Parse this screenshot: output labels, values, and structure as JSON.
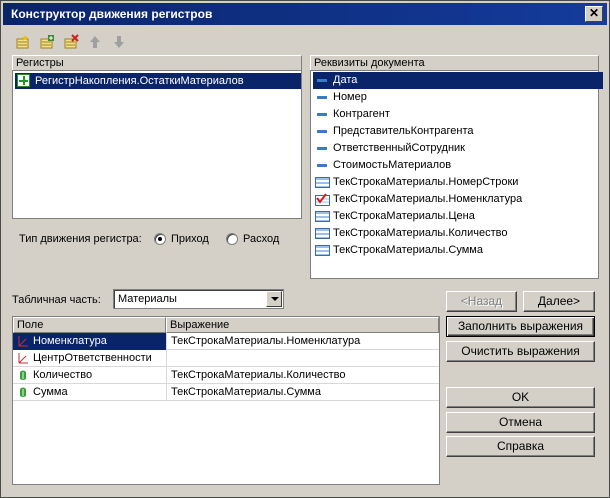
{
  "window": {
    "title": "Конструктор движения регистров",
    "close_label": "✕"
  },
  "toolbar": {
    "icons": [
      "add-register-icon",
      "add-register-alt-icon",
      "delete-register-icon",
      "move-up-icon",
      "move-down-icon"
    ]
  },
  "registers": {
    "header": "Регистры",
    "items": [
      {
        "label": "РегистрНакопления.ОстаткиМатериалов",
        "selected": true
      }
    ]
  },
  "requisites": {
    "header": "Реквизиты документа",
    "items": [
      {
        "label": "Дата",
        "icon": "attribute-icon",
        "selected": true
      },
      {
        "label": "Номер",
        "icon": "attribute-icon"
      },
      {
        "label": "Контрагент",
        "icon": "attribute-icon"
      },
      {
        "label": "ПредставительКонтрагента",
        "icon": "attribute-icon"
      },
      {
        "label": "ОтветственныйСотрудник",
        "icon": "attribute-icon"
      },
      {
        "label": "СтоимостьМатериалов",
        "icon": "attribute-icon"
      },
      {
        "label": "ТекСтрокаМатериалы.НомерСтроки",
        "icon": "table-icon"
      },
      {
        "label": "ТекСтрокаМатериалы.Номенклатура",
        "icon": "table-check-icon"
      },
      {
        "label": "ТекСтрокаМатериалы.Цена",
        "icon": "table-icon"
      },
      {
        "label": "ТекСтрокаМатериалы.Количество",
        "icon": "table-icon"
      },
      {
        "label": "ТекСтрокаМатериалы.Сумма",
        "icon": "table-icon"
      }
    ]
  },
  "movement": {
    "label": "Тип движения регистра:",
    "options": [
      {
        "label": "Приход",
        "checked": true
      },
      {
        "label": "Расход",
        "checked": false
      }
    ]
  },
  "tabular": {
    "label": "Табличная часть:",
    "value": "Материалы"
  },
  "grid": {
    "columns": [
      "Поле",
      "Выражение"
    ],
    "rows": [
      {
        "field": "Номенклатура",
        "expr": "ТекСтрокаМатериалы.Номенклатура",
        "icon": "dimension-icon",
        "selected": true
      },
      {
        "field": "ЦентрОтветственности",
        "expr": "",
        "icon": "dimension-icon"
      },
      {
        "field": "Количество",
        "expr": "ТекСтрокаМатериалы.Количество",
        "icon": "resource-icon"
      },
      {
        "field": "Сумма",
        "expr": "ТекСтрокаМатериалы.Сумма",
        "icon": "resource-icon"
      }
    ]
  },
  "buttons": {
    "back": "<Назад",
    "next": "Далее>",
    "fill": "Заполнить выражения",
    "clear": "Очистить выражения",
    "ok": "OK",
    "cancel": "Отмена",
    "help": "Справка"
  }
}
